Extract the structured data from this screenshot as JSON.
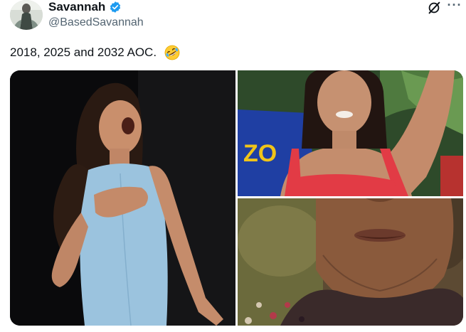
{
  "author": {
    "display_name": "Savannah",
    "handle": "@BasedSavannah",
    "verified": true,
    "avatar_icon": "avatar-image"
  },
  "header_actions": {
    "grok_icon": "grok-icon",
    "more_icon": "more-horizontal-icon",
    "more_glyph": "···"
  },
  "tweet": {
    "text": "2018, 2025 and 2032 AOC.",
    "emoji": "rolling-on-floor-laughing-emoji"
  },
  "media": {
    "photos": [
      {
        "name": "photo-woman-blue-dress",
        "icon": "photo"
      },
      {
        "name": "photo-woman-red-top",
        "icon": "photo"
      },
      {
        "name": "photo-older-woman-closeup",
        "icon": "photo"
      }
    ],
    "sign_text": "ZO"
  },
  "colors": {
    "verified_blue": "#1d9bf0",
    "text_primary": "#0f1419",
    "text_secondary": "#536471"
  }
}
